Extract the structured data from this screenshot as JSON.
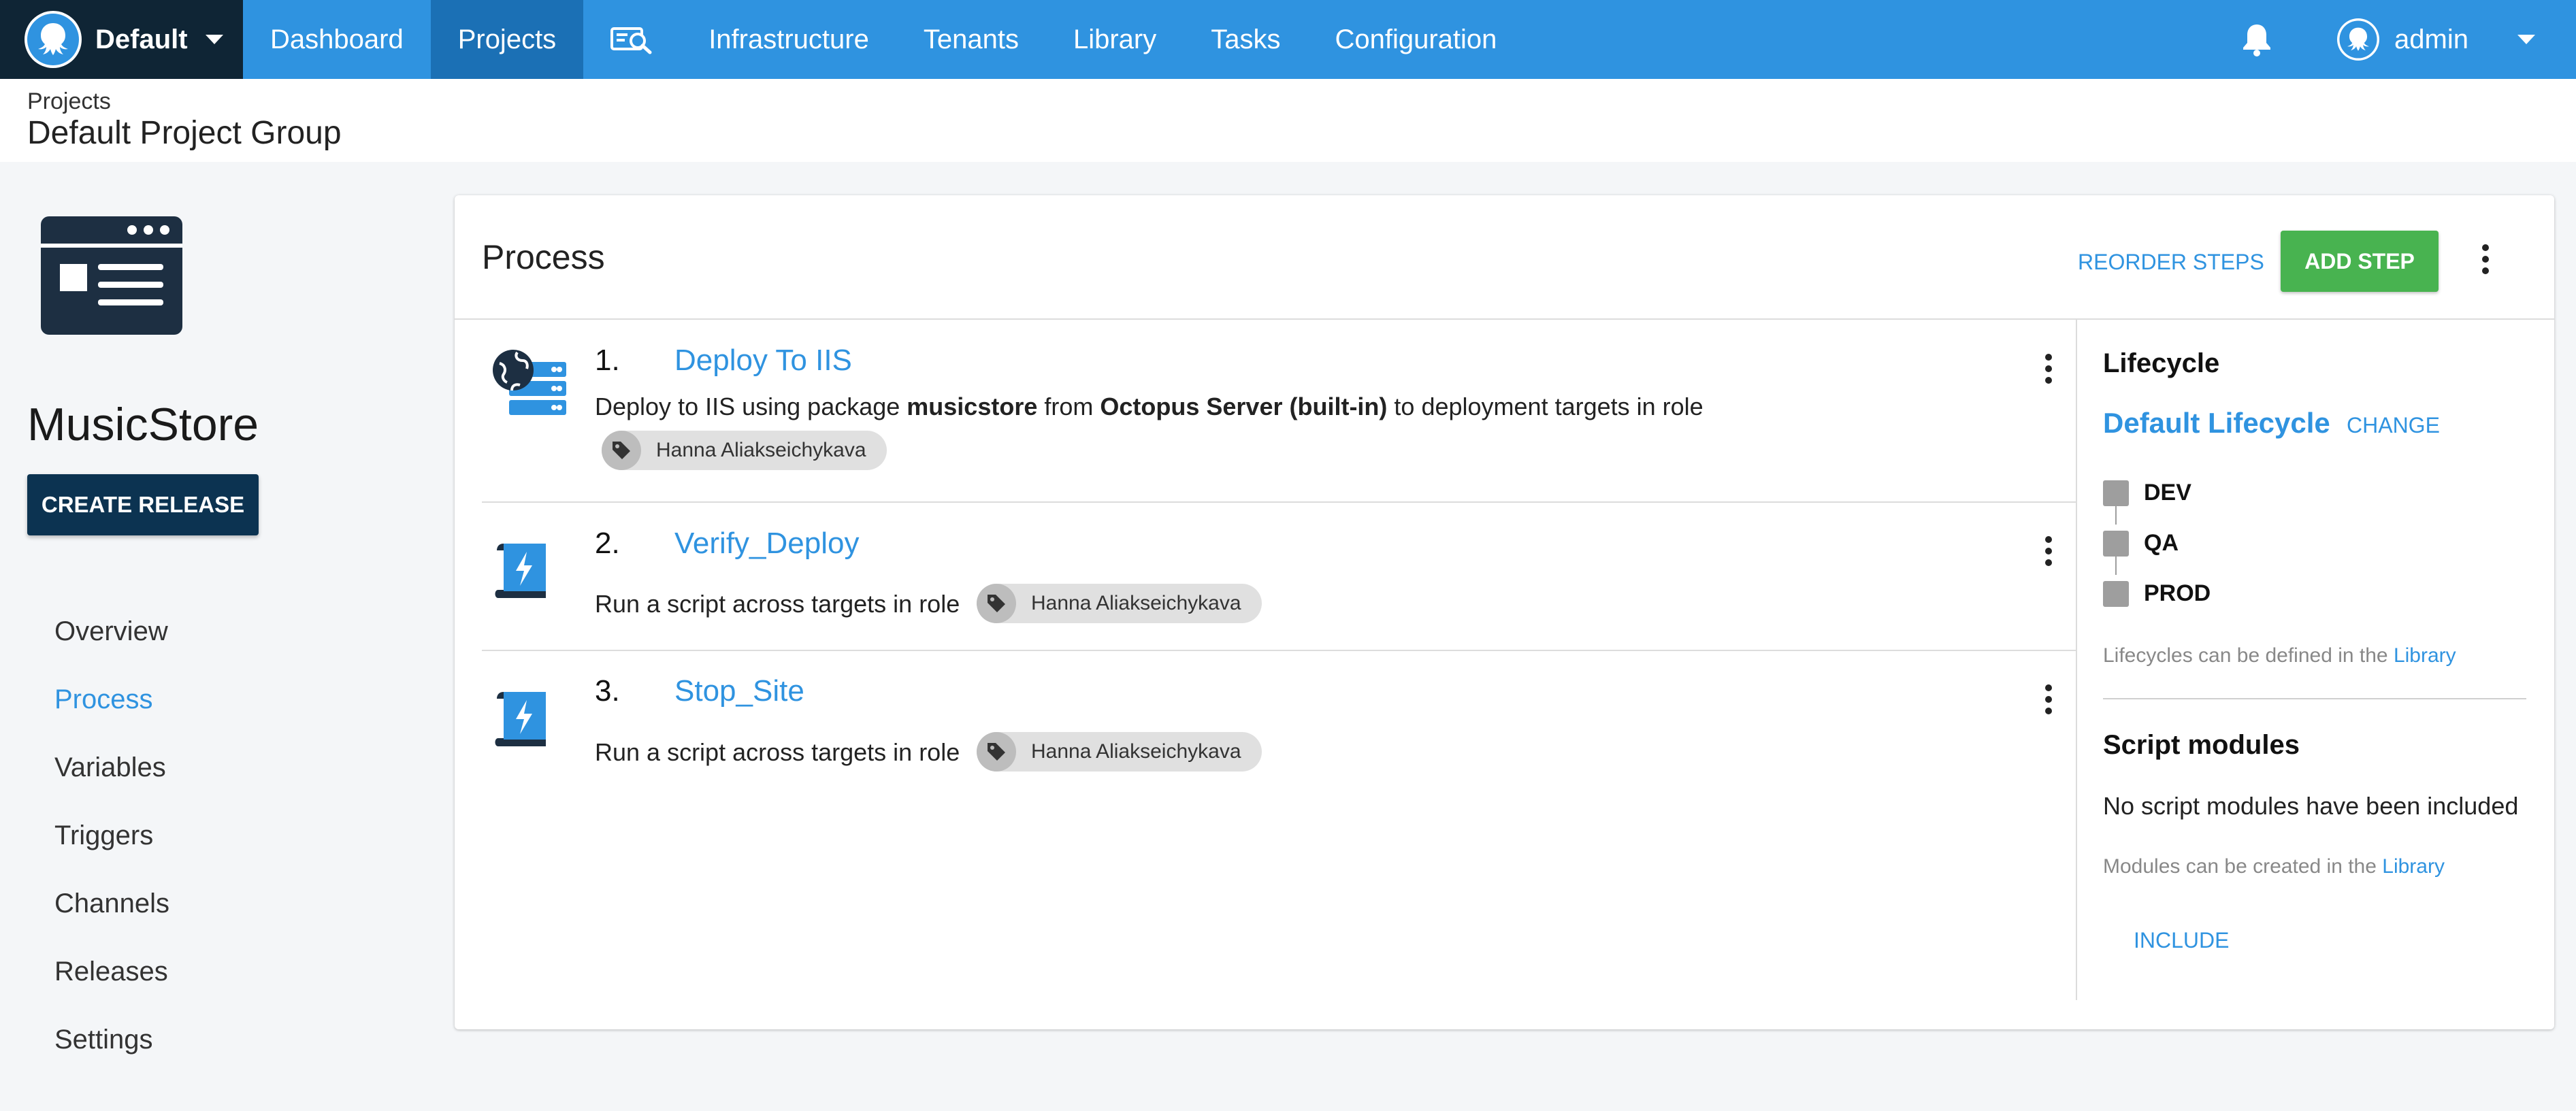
{
  "topnav": {
    "space": "Default",
    "items": [
      {
        "label": "Dashboard",
        "active": false
      },
      {
        "label": "Projects",
        "active": true
      },
      {
        "label": "Infrastructure",
        "active": false
      },
      {
        "label": "Tenants",
        "active": false
      },
      {
        "label": "Library",
        "active": false
      },
      {
        "label": "Tasks",
        "active": false
      },
      {
        "label": "Configuration",
        "active": false
      }
    ],
    "user": "admin",
    "icons": [
      "octopus-logo-icon",
      "search-icon",
      "bell-icon",
      "user-avatar-icon"
    ]
  },
  "breadcrumb": {
    "parent": "Projects",
    "title": "Default Project Group"
  },
  "sidebar": {
    "project_name": "MusicStore",
    "create_release": "CREATE RELEASE",
    "items": [
      {
        "label": "Overview",
        "active": false
      },
      {
        "label": "Process",
        "active": true
      },
      {
        "label": "Variables",
        "active": false
      },
      {
        "label": "Triggers",
        "active": false
      },
      {
        "label": "Channels",
        "active": false
      },
      {
        "label": "Releases",
        "active": false
      },
      {
        "label": "Settings",
        "active": false
      }
    ]
  },
  "process": {
    "title": "Process",
    "reorder": "REORDER STEPS",
    "add_step": "ADD STEP",
    "steps": [
      {
        "number": "1.",
        "name": "Deploy To IIS",
        "icon": "iis-server-icon",
        "desc_1": "Deploy to IIS using package ",
        "package": "musicstore",
        "desc_2": " from ",
        "feed": "Octopus Server (built-in)",
        "desc_3": " to deployment targets in role",
        "role": "Hanna Aliakseichykava"
      },
      {
        "number": "2.",
        "name": "Verify_Deploy",
        "icon": "script-icon",
        "desc": "Run a script across targets in role",
        "role": "Hanna Aliakseichykava"
      },
      {
        "number": "3.",
        "name": "Stop_Site",
        "icon": "script-icon",
        "desc": "Run a script across targets in role",
        "role": "Hanna Aliakseichykava"
      }
    ]
  },
  "lifecycle": {
    "title": "Lifecycle",
    "name": "Default Lifecycle",
    "change": "CHANGE",
    "phases": [
      "DEV",
      "QA",
      "PROD"
    ],
    "hint": "Lifecycles can be defined in the ",
    "hint_link": "Library"
  },
  "script_modules": {
    "title": "Script modules",
    "empty": "No script modules have been included",
    "hint": "Modules can be created in the ",
    "hint_link": "Library",
    "include": "INCLUDE"
  },
  "colors": {
    "nav_blue": "#2f93e0",
    "nav_dark": "#0f2535",
    "nav_active": "#1b70b5",
    "button_navy": "#0c3351",
    "button_green": "#48b350",
    "link_blue": "#2f93e0"
  }
}
